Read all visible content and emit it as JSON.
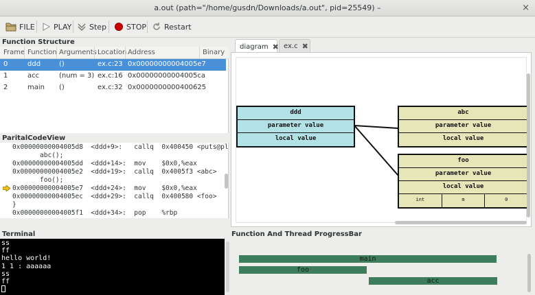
{
  "window": {
    "title": "a.out (path=\"/home/gusdn/Downloads/a.out\", pid=25549) –",
    "close_glyph": "×"
  },
  "toolbar": {
    "file_label": "FILE",
    "play_label": "PLAY",
    "step_label": "Step",
    "stop_label": "STOP",
    "restart_label": "Restart",
    "stop_color": "#cc0000"
  },
  "function_structure": {
    "title": "Function Structure",
    "columns": [
      "Frame",
      "Function",
      "Arguments",
      "Location",
      "Address",
      "Binary"
    ],
    "rows": [
      {
        "frame": "0",
        "function": "ddd",
        "arguments": "()",
        "location": "ex.c:23",
        "address": "0x00000000004005e7",
        "selected": true
      },
      {
        "frame": "1",
        "function": "acc",
        "arguments": "(num = 3)",
        "location": "ex.c:16",
        "address": "0x00000000004005ca",
        "selected": false
      },
      {
        "frame": "2",
        "function": "main",
        "arguments": "()",
        "location": "ex.c:32",
        "address": "0x0000000000400625",
        "selected": false
      }
    ]
  },
  "code_view": {
    "title": "ParitalCodeView",
    "current_line_marker": "arrow-right-icon",
    "lines": [
      "0x00000000004005d8  <ddd+9>:   callq  0x400450 <puts@pl",
      "       abc();",
      "0x00000000004005dd  <ddd+14>:  mov    $0x0,%eax",
      "0x00000000004005e2  <ddd+19>:  callq  0x4005f3 <abc>",
      "       foo();",
      "0x00000000004005e7  <ddd+24>:  mov    $0x0,%eax",
      "0x00000000004005ec  <ddd+29>:  callq  0x400580 <foo>",
      "}",
      "0x00000000004005f1  <ddd+34>:  pop    %rbp"
    ],
    "current_index": 5
  },
  "tabs": [
    {
      "label": "diagram",
      "active": true,
      "close": "✖"
    },
    {
      "label": "ex.c",
      "active": false,
      "close": "✖"
    }
  ],
  "diagram": {
    "boxes": [
      {
        "name": "ddd",
        "rows": [
          "ddd",
          "parameter value",
          "local value"
        ],
        "color": "#b3e2e6"
      },
      {
        "name": "abc",
        "rows": [
          "abc",
          "parameter value",
          "local value"
        ],
        "color": "#e6e6b8"
      },
      {
        "name": "foo",
        "rows": [
          "foo",
          "parameter value",
          "local value"
        ],
        "color": "#e6e6b8",
        "cells": [
          "int",
          "m",
          "0"
        ]
      }
    ]
  },
  "terminal": {
    "title": "Terminal",
    "lines": [
      "ss",
      "ff",
      "hello world!",
      "1 1 : aaaaaa",
      "ss",
      "ff"
    ]
  },
  "progress": {
    "title": "Function And Thread ProgressBar",
    "bars": [
      {
        "label": "main"
      },
      {
        "label": "foo"
      },
      {
        "label": "acc"
      }
    ],
    "bar_color": "#3e7d5c"
  }
}
